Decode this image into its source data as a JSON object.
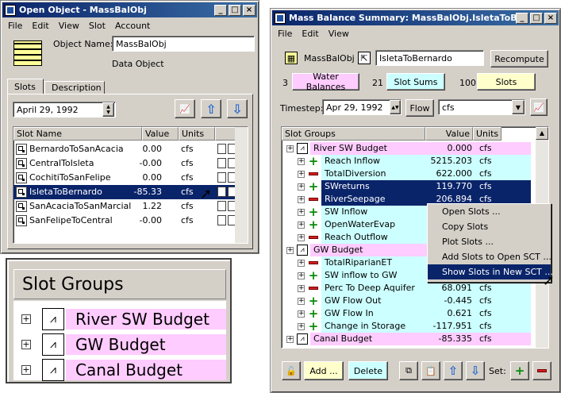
{
  "left_window": {
    "title": "Open Object - MassBalObj",
    "menu": [
      "File",
      "Edit",
      "View",
      "Slot",
      "Account"
    ],
    "object_name_label": "Object Name:",
    "object_name": "MassBalObj",
    "object_type": "Data Object",
    "tabs": [
      "Slots",
      "Description"
    ],
    "date": "April 29, 1992",
    "columns": [
      "Slot Name",
      "Value",
      "Units"
    ],
    "rows": [
      {
        "name": "BernardoToSanAcacia",
        "value": "0.00",
        "units": "cfs"
      },
      {
        "name": "CentralToIsleta",
        "value": "-0.00",
        "units": "cfs"
      },
      {
        "name": "CochitiToSanFelipe",
        "value": "0.00",
        "units": "cfs"
      },
      {
        "name": "IsletaToBernardo",
        "value": "-85.33",
        "units": "cfs"
      },
      {
        "name": "SanAcaciaToSanMarcial",
        "value": "1.22",
        "units": "cfs"
      },
      {
        "name": "SanFelipeToCentral",
        "value": "-0.00",
        "units": "cfs"
      }
    ]
  },
  "zoom": {
    "header": "Slot Groups",
    "items": [
      "River SW Budget",
      "GW Budget",
      "Canal Budget"
    ]
  },
  "right_window": {
    "title": "Mass Balance Summary: MassBalObj.IsletaToBern...",
    "menu": [
      "File",
      "Edit",
      "View"
    ],
    "object": "MassBalObj",
    "slot": "IsletaToBernardo",
    "recompute": "Recompute",
    "counts": [
      {
        "n": "3",
        "label": "Water Balances",
        "color": "#ffccff"
      },
      {
        "n": "21",
        "label": "Slot Sums",
        "color": "#ccffff"
      },
      {
        "n": "100",
        "label": "Slots",
        "color": "#ffffcc"
      }
    ],
    "timestep_label": "Timestep:",
    "timestep": "Apr 29, 1992",
    "flow": "Flow",
    "units": "cfs",
    "columns": [
      "Slot Groups",
      "Value",
      "Units"
    ],
    "rows": [
      {
        "name": "River SW Budget",
        "value": "0.000",
        "units": "cfs",
        "kind": "group"
      },
      {
        "name": "Reach Inflow",
        "value": "5215.203",
        "units": "cfs",
        "kind": "plus"
      },
      {
        "name": "TotalDiversion",
        "value": "622.000",
        "units": "cfs",
        "kind": "minus"
      },
      {
        "name": "SWreturns",
        "value": "119.770",
        "units": "cfs",
        "kind": "plus"
      },
      {
        "name": "RiverSeepage",
        "value": "206.894",
        "units": "cfs",
        "kind": "minus"
      },
      {
        "name": "SW Inflow",
        "value": "",
        "units": "",
        "kind": "plus"
      },
      {
        "name": "OpenWaterEvap",
        "value": "",
        "units": "",
        "kind": "plus"
      },
      {
        "name": "Reach Outflow",
        "value": "",
        "units": "",
        "kind": "minus"
      },
      {
        "name": "GW Budget",
        "value": "",
        "units": "",
        "kind": "group"
      },
      {
        "name": "TotalRiparianET",
        "value": "",
        "units": "",
        "kind": "minus"
      },
      {
        "name": "SW inflow to GW",
        "value": "",
        "units": "",
        "kind": "plus"
      },
      {
        "name": "Perc To Deep Aquifer",
        "value": "68.091",
        "units": "cfs",
        "kind": "minus"
      },
      {
        "name": "GW Flow Out",
        "value": "-0.445",
        "units": "cfs",
        "kind": "plus"
      },
      {
        "name": "GW Flow In",
        "value": "0.621",
        "units": "cfs",
        "kind": "plus"
      },
      {
        "name": "Change in Storage",
        "value": "-117.951",
        "units": "cfs",
        "kind": "plus"
      },
      {
        "name": "Canal Budget",
        "value": "-85.335",
        "units": "cfs",
        "kind": "group"
      }
    ],
    "context_menu": [
      "Open Slots ...",
      "Copy Slots",
      "Plot Slots ...",
      "Add Slots to Open SCT ...",
      "Show Slots in New SCT ..."
    ],
    "buttons": {
      "add": "Add ...",
      "delete": "Delete",
      "set": "Set:"
    }
  }
}
